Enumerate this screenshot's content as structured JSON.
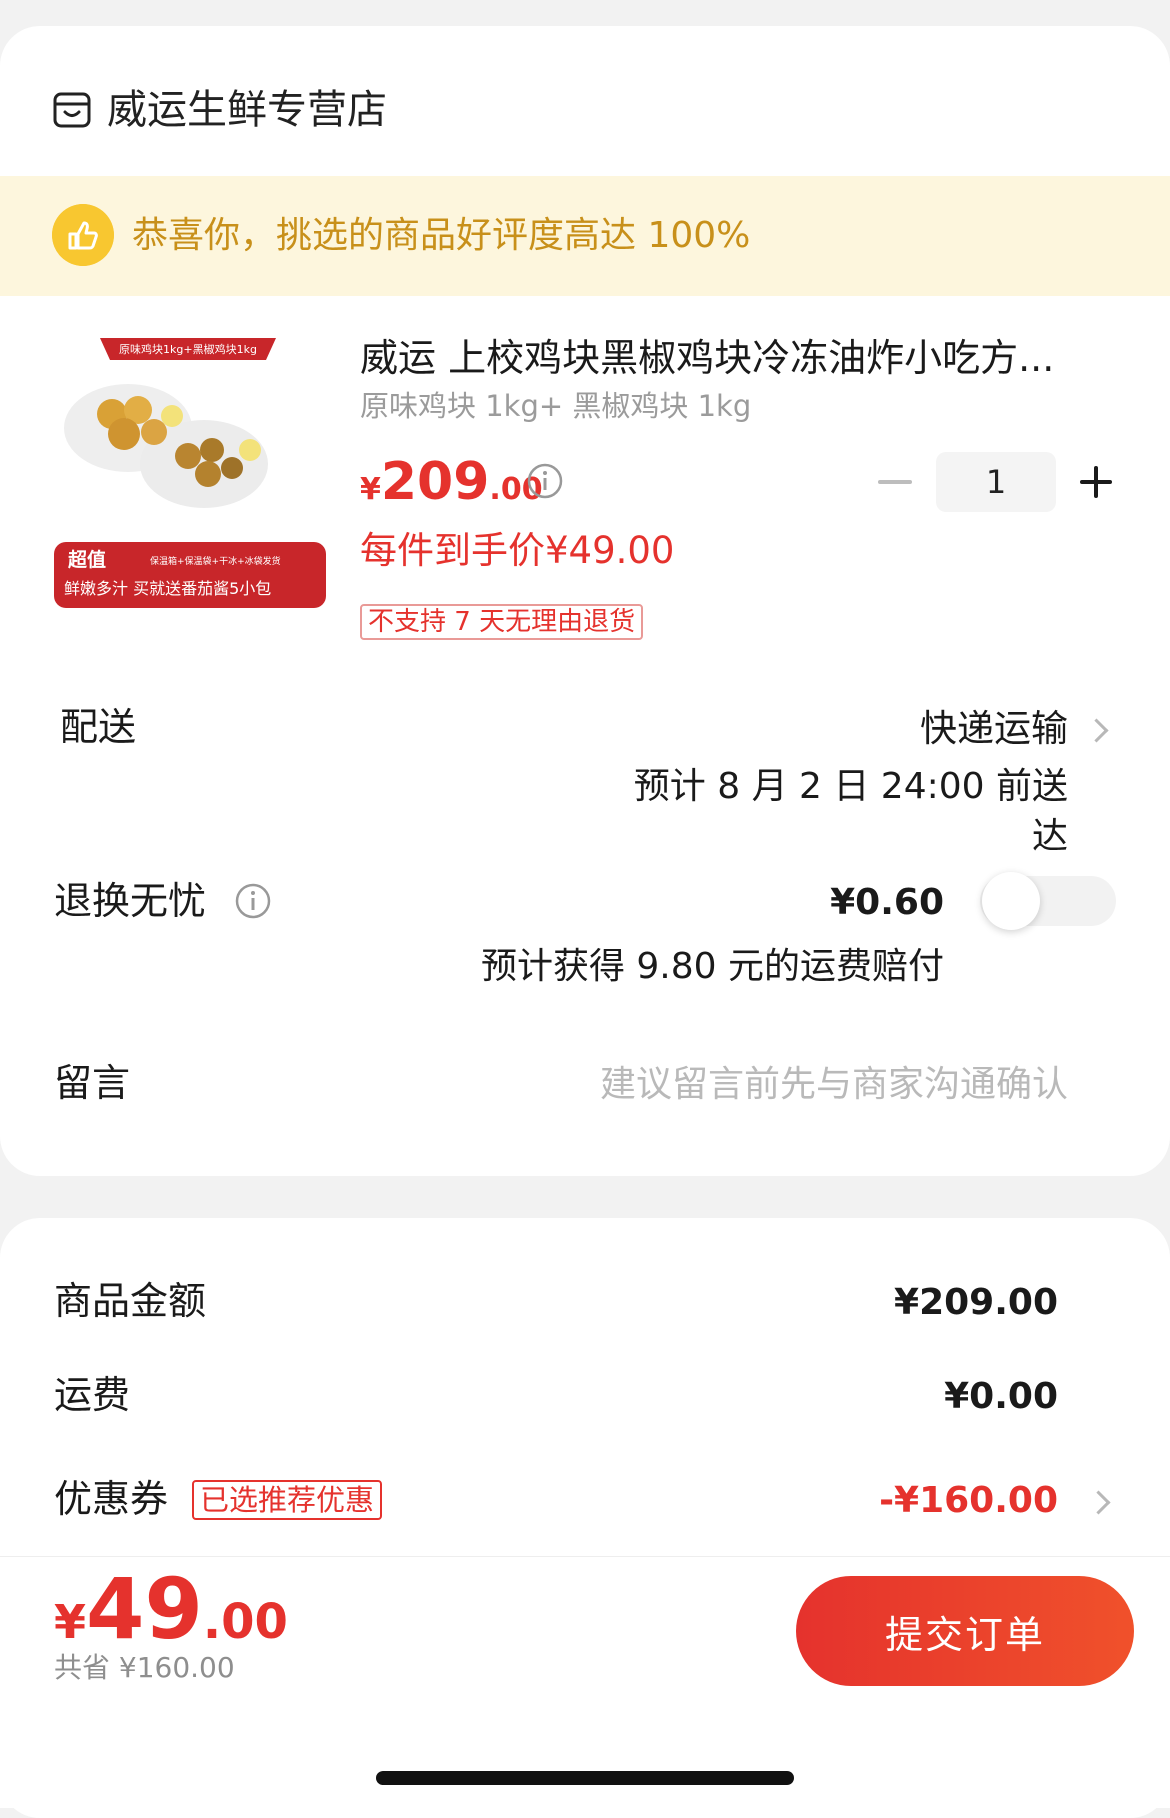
{
  "store": {
    "name": "威运生鲜专营店",
    "icon": "store-icon"
  },
  "banner": {
    "text": "恭喜你，挑选的商品好评度高达 100%",
    "icon": "thumbs-up-icon"
  },
  "product": {
    "image_top_text": "原味鸡块1kg+黑椒鸡块1kg",
    "image_badge": "超值",
    "image_badge_note": "保温箱+保温袋+干冰+冰袋发货",
    "image_bottom_text": "鲜嫩多汁 买就送番茄酱5小包",
    "title": "威运 上校鸡块黑椒鸡块冷冻油炸小吃方...",
    "spec": "原味鸡块 1kg+ 黑椒鸡块 1kg",
    "price_symbol": "¥",
    "price_integer": "209",
    "price_decimal": ".00",
    "per_item_price": "每件到手价¥49.00",
    "return_policy": "不支持 7 天无理由退货",
    "quantity": "1"
  },
  "delivery": {
    "label": "配送",
    "method": "快递运输",
    "eta": "预计 8 月 2 日 24:00 前送达"
  },
  "return_insurance": {
    "label": "退换无忧",
    "price": "¥0.60",
    "note": "预计获得 9.80 元的运费赔付",
    "enabled": false
  },
  "message": {
    "label": "留言",
    "placeholder": "建议留言前先与商家沟通确认"
  },
  "summary": {
    "goods_label": "商品金额",
    "goods_value": "¥209.00",
    "shipping_label": "运费",
    "shipping_value": "¥0.00",
    "coupon_label": "优惠券",
    "coupon_badge": "已选推荐优惠",
    "coupon_value": "-¥160.00"
  },
  "checkout": {
    "total_symbol": "¥",
    "total_integer": "49",
    "total_decimal": ".00",
    "saved": "共省 ¥160.00",
    "submit_label": "提交订单"
  },
  "colors": {
    "accent": "#e5322d",
    "banner_bg": "#fdf6dd",
    "banner_text": "#c8901a"
  }
}
